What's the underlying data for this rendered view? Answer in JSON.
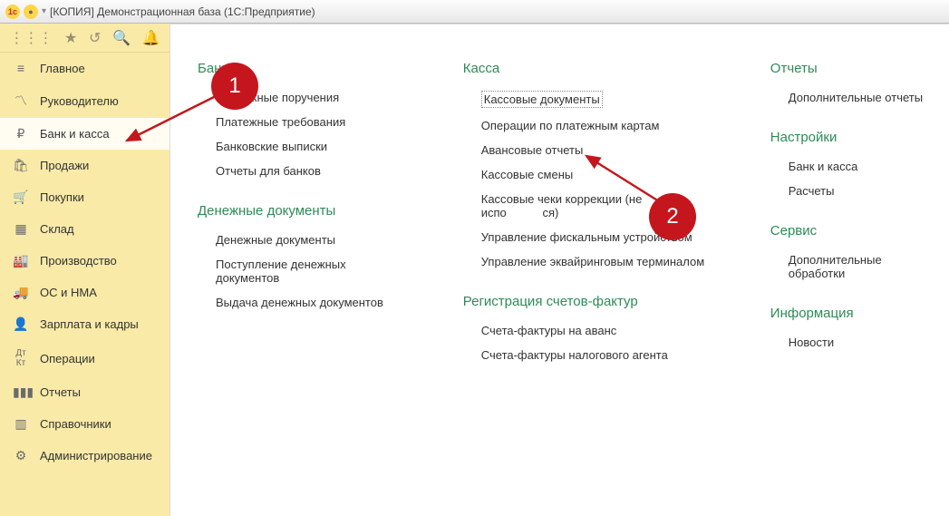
{
  "window": {
    "title": "[КОПИЯ] Демонстрационная база  (1С:Предприятие)"
  },
  "sidebar": {
    "items": [
      {
        "label": "Главное"
      },
      {
        "label": "Руководителю"
      },
      {
        "label": "Банк и касса"
      },
      {
        "label": "Продажи"
      },
      {
        "label": "Покупки"
      },
      {
        "label": "Склад"
      },
      {
        "label": "Производство"
      },
      {
        "label": "ОС и НМА"
      },
      {
        "label": "Зарплата и кадры"
      },
      {
        "label": "Операции"
      },
      {
        "label": "Отчеты"
      },
      {
        "label": "Справочники"
      },
      {
        "label": "Администрирование"
      }
    ]
  },
  "columns": {
    "c1": {
      "bank": {
        "title": "Банк",
        "items": [
          "Платежные поручения",
          "Платежные требования",
          "Банковские выписки",
          "Отчеты для банков"
        ]
      },
      "moneydocs": {
        "title": "Денежные документы",
        "items": [
          "Денежные документы",
          "Поступление денежных документов",
          "Выдача денежных документов"
        ]
      }
    },
    "c2": {
      "kassa": {
        "title": "Касса",
        "items": [
          "Кассовые документы",
          "Операции по платежным картам",
          "Авансовые отчеты",
          "Кассовые смены",
          "Кассовые чеки коррекции (не испо",
          "Управление фискальным устройством",
          "Управление эквайринговым терминалом"
        ],
        "item4_suffix": "ся)"
      },
      "reg": {
        "title": "Регистрация счетов-фактур",
        "items": [
          "Счета-фактуры на аванс",
          "Счета-фактуры налогового агента"
        ]
      }
    },
    "c3": {
      "reports": {
        "title": "Отчеты",
        "items": [
          "Дополнительные отчеты"
        ]
      },
      "settings": {
        "title": "Настройки",
        "items": [
          "Банк и касса",
          "Расчеты"
        ]
      },
      "service": {
        "title": "Сервис",
        "items": [
          "Дополнительные обработки"
        ]
      },
      "info": {
        "title": "Информация",
        "items": [
          "Новости"
        ]
      }
    }
  },
  "markers": {
    "m1": "1",
    "m2": "2"
  }
}
